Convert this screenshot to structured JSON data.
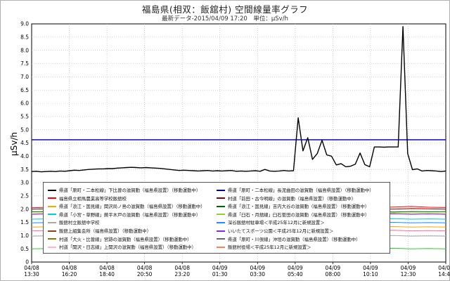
{
  "header": {
    "title": "福島県(相双：飯舘村) 空間線量率グラフ",
    "subtitle": "最新データ-2015/04/09 17:20　単位：μSv/h"
  },
  "chart_data": {
    "type": "line",
    "ylabel": "μSv/h",
    "ylim": [
      0,
      9.0
    ],
    "yticks": [
      "0",
      "0.5",
      "1.0",
      "1.5",
      "2.0",
      "2.5",
      "3.0",
      "3.5",
      "4.0",
      "4.5",
      "5.0",
      "5.5",
      "6.0",
      "6.5",
      "7.0",
      "7.5",
      "8.0",
      "8.5",
      "9.0"
    ],
    "xticks": [
      [
        "04/08",
        "13:30"
      ],
      [
        "04/08",
        "16:20"
      ],
      [
        "04/08",
        "18:40"
      ],
      [
        "04/08",
        "20:50"
      ],
      [
        "04/08",
        "23:20"
      ],
      [
        "04/09",
        "01:30"
      ],
      [
        "04/09",
        "03:30"
      ],
      [
        "04/09",
        "05:40"
      ],
      [
        "04/09",
        "08:00"
      ],
      [
        "04/09",
        "10:10"
      ],
      [
        "04/09",
        "12:30"
      ],
      [
        "04/09",
        "14:40"
      ]
    ],
    "grid": true,
    "reference_line": {
      "value": 4.62,
      "color": "#1b1bc8"
    },
    "series": [
      {
        "color": "#000000",
        "values": [
          3.42,
          3.43,
          3.41,
          3.42,
          3.43,
          3.42,
          3.44,
          3.43,
          3.45,
          3.47,
          3.46,
          3.48,
          3.5,
          3.51,
          3.52,
          3.52,
          3.53,
          3.53,
          3.55,
          3.56,
          3.57,
          3.58,
          3.57,
          3.56,
          3.57,
          3.56,
          3.55,
          3.54,
          3.52,
          3.5,
          3.48,
          3.46,
          3.47,
          3.46,
          3.45,
          3.44,
          3.45,
          3.46,
          3.44,
          3.45,
          3.44,
          3.45,
          3.46,
          3.43,
          3.44,
          3.43,
          3.44,
          3.45,
          3.43,
          3.5,
          3.44,
          3.43,
          3.44,
          3.46,
          3.44,
          3.45,
          5.45,
          4.2,
          4.7,
          3.88,
          4.1,
          4.6,
          4.05,
          4.0,
          3.67,
          3.72,
          3.6,
          3.62,
          3.7,
          4.12,
          3.68,
          3.6,
          4.35,
          4.35,
          4.34,
          4.35,
          4.35,
          4.35,
          8.9,
          4.1,
          3.49,
          3.52,
          3.44,
          3.46,
          3.45,
          3.44,
          3.42,
          3.44
        ]
      },
      {
        "color": "#ff0000",
        "values": [
          2.05,
          2.07,
          2.06,
          2.08,
          2.05,
          2.06,
          2.07,
          2.08,
          2.06,
          2.05,
          2.07,
          2.06,
          2.05,
          2.08,
          2.06,
          2.07,
          2.05,
          2.06,
          2.07,
          2.05,
          2.06,
          2.08,
          2.1,
          2.07,
          2.06
        ]
      },
      {
        "color": "#8b0000",
        "values": [
          2.0,
          2.01,
          1.99,
          2.0,
          2.02,
          2.01,
          2.0,
          1.99,
          2.01,
          2.02,
          2.0,
          2.01,
          1.99,
          2.0,
          2.01,
          2.0,
          2.02,
          2.01,
          2.0,
          1.99,
          2.01,
          2.0,
          2.02,
          2.01,
          2.0
        ]
      },
      {
        "color": "#006400",
        "values": [
          1.9,
          1.91,
          1.89,
          1.9,
          1.92,
          1.91,
          1.9,
          1.89,
          1.91,
          1.9,
          1.92,
          1.91,
          1.9,
          1.89,
          1.91,
          1.9,
          1.91,
          1.9,
          1.92,
          1.91,
          1.9,
          1.89,
          1.91,
          1.9,
          1.91
        ]
      },
      {
        "color": "#9acd32",
        "values": [
          1.84,
          1.85,
          1.83,
          1.84,
          1.85,
          1.84,
          1.86,
          1.85,
          1.84,
          1.83,
          1.85,
          1.84,
          1.85,
          1.84,
          1.86,
          1.85,
          1.84,
          1.85,
          1.83,
          1.84,
          1.85,
          1.86,
          1.84,
          1.85,
          1.84
        ]
      },
      {
        "color": "#8a2be2",
        "values": [
          1.8,
          1.81,
          1.8,
          1.79,
          1.81,
          1.8,
          1.82,
          1.81,
          1.8,
          1.79,
          1.81,
          1.8,
          1.81,
          1.8,
          1.82,
          1.81,
          1.8,
          1.79,
          1.81,
          1.8,
          1.81,
          1.82,
          1.8,
          1.81,
          1.8
        ]
      },
      {
        "color": "#00ced1",
        "values": [
          1.62,
          1.63,
          1.62,
          1.61,
          1.63,
          1.62,
          1.64,
          1.63,
          1.62,
          1.61,
          1.63,
          1.62,
          1.63,
          1.62,
          1.64,
          1.63,
          1.62,
          1.61,
          1.63,
          1.62,
          1.63,
          1.64,
          1.62,
          1.63,
          1.62
        ]
      },
      {
        "color": "#1e90ff",
        "values": [
          1.48,
          1.49,
          1.48,
          1.47,
          1.49,
          1.48,
          1.5,
          1.49,
          1.48,
          1.47,
          1.49,
          1.48,
          1.49,
          1.48,
          1.5,
          1.49,
          1.48,
          1.47,
          1.49,
          1.48,
          1.49,
          1.5,
          1.48,
          1.49,
          1.48
        ]
      },
      {
        "color": "#ffa500",
        "values": [
          1.32,
          1.33,
          1.32,
          1.31,
          1.33,
          1.32,
          1.34,
          1.33,
          1.32,
          1.31,
          1.33,
          1.32,
          1.33,
          1.32,
          1.34,
          1.33,
          1.32,
          1.31,
          1.33,
          1.32,
          1.33,
          1.34,
          1.32,
          1.33,
          1.32
        ]
      },
      {
        "color": "#ff69b4",
        "values": [
          1.18,
          1.19,
          1.18,
          1.17,
          1.19,
          1.18,
          1.2,
          1.19,
          1.18,
          1.17,
          1.19,
          1.18,
          1.19,
          1.18,
          1.2,
          1.19,
          1.18,
          1.17,
          1.19,
          1.18,
          1.19,
          1.2,
          1.18,
          1.19,
          1.18
        ]
      },
      {
        "color": "#a9a9a9",
        "values": [
          0.98,
          0.99,
          0.98,
          0.97,
          0.99,
          0.98,
          1.0,
          0.99,
          0.98,
          0.97,
          0.99,
          0.98,
          0.99,
          0.98,
          1.0,
          0.99,
          0.98,
          0.97,
          0.99,
          0.98,
          0.99,
          1.0,
          0.98,
          0.99,
          0.98
        ]
      },
      {
        "color": "#32cd32",
        "values": [
          0.5,
          0.51,
          0.5,
          0.49,
          0.51,
          0.5,
          0.52,
          0.51,
          0.5,
          0.49,
          0.51,
          0.5,
          0.51,
          0.5,
          0.52,
          0.51,
          0.5,
          0.49,
          0.51,
          0.5,
          0.51,
          0.52,
          0.5,
          0.51,
          0.5
        ]
      }
    ],
    "legend": {
      "placement": "bottom-center",
      "entries": [
        {
          "label": "県道「原町・二本松線」下比曽の滋賀動（福島県設置）（移動運動中）",
          "color": "#000000"
        },
        {
          "label": "県道「原町・二本松線」長泥曲田の滋賀動（福島県設置）（移動運動中）",
          "color": "#00008b"
        },
        {
          "label": "福島県立相馬農業高等学校飯舘校",
          "color": "#ff0000"
        },
        {
          "label": "村道「前田・古今明線」の滋賀動（福島県設置）（移動運動中）",
          "color": "#8b0000"
        },
        {
          "label": "県道「浪江・国見線」関沢局ノ島の滋賀動（福島県設置）（移動運動中）",
          "color": "#ffa500"
        },
        {
          "label": "県道「浪江・国見線」吉内大谷の滋賀動（福島県設置）（移動運動中）",
          "color": "#006400"
        },
        {
          "label": "県道「小宮・草野線」蕨平木戸の滋賀動（福島県設置）（移動運動中）",
          "color": "#00ced1"
        },
        {
          "label": "県道「臼石・月舘線」臼石菅田の滋賀動（福島県設置）（移動運動中）",
          "color": "#9acd32"
        },
        {
          "label": "飯舘村立飯舘中学校",
          "color": "#a9a9a9"
        },
        {
          "label": "深谷飯舘村駐車場＜平成25年12月に新規設置＞",
          "color": "#1e90ff"
        },
        {
          "label": "飯舘上組集会所（福島県設置）（移動運動中）",
          "color": "#8b4513"
        },
        {
          "label": "いいたてスポーツ公園＜平成25年12月に新規設置＞",
          "color": "#8a2be2"
        },
        {
          "label": "村道「大火・比曽線」宮跡の滋賀動（福島県設置）（移動運動中）",
          "color": "#808000"
        },
        {
          "label": "県道「原町・川俣線」沖垣の滋賀動（福島県設置）（移動運動中）",
          "color": "#696969"
        },
        {
          "label": "村道「関沢・日志線」上関沢の滋賀動（福島県設置）（移動運動中）",
          "color": "#ffb6c1"
        },
        {
          "label": "飯舘村役場＜平成25年12月に新規設置＞",
          "color": "#ff7f50"
        }
      ]
    }
  }
}
